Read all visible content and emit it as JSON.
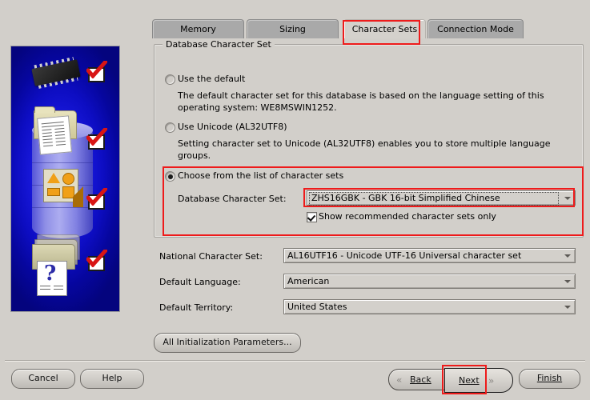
{
  "window": {
    "background_color": "#d2cfca",
    "accent_highlight_color": "#ee1b1b"
  },
  "sidebar": {
    "illustration_name": "oracle-dbca-database-illustration",
    "background_color": "#0d0dc2",
    "items": [
      {
        "icon": "memory-chip-icon",
        "status_icon": "red-check-arrow-icon"
      },
      {
        "icon": "folder-with-documents-icon",
        "status_icon": "red-check-arrow-icon"
      },
      {
        "icon": "orange-shapes-tile-icon",
        "status_icon": "red-check-arrow-icon"
      },
      {
        "icon": "folders-stack-question-icon",
        "status_icon": "red-check-arrow-icon"
      }
    ]
  },
  "tabs": [
    {
      "label": "Memory",
      "active": false,
      "name": "tab-memory"
    },
    {
      "label": "Sizing",
      "active": false,
      "name": "tab-sizing"
    },
    {
      "label": "Character Sets",
      "active": true,
      "name": "tab-character-sets"
    },
    {
      "label": "Connection Mode",
      "active": false,
      "name": "tab-connection-mode"
    }
  ],
  "group": {
    "title": "Database Character Set",
    "options": [
      {
        "id": "use-the-default",
        "label": "Use the default",
        "selected": false,
        "description": "The default character set for this database is based on the language setting of this operating system: WE8MSWIN1252."
      },
      {
        "id": "use-unicode",
        "label": "Use Unicode (AL32UTF8)",
        "selected": false,
        "description": "Setting character set to Unicode (AL32UTF8) enables you to store multiple language groups."
      },
      {
        "id": "choose-from-list",
        "label": "Choose from the list of character sets",
        "selected": true,
        "description": ""
      }
    ],
    "database_character_set": {
      "label": "Database Character Set:",
      "value": "ZHS16GBK - GBK 16-bit Simplified Chinese",
      "focused": true
    },
    "show_recommended": {
      "label": "Show recommended character sets only",
      "checked": true
    }
  },
  "fields": [
    {
      "label": "National Character Set:",
      "value": "AL16UTF16 - Unicode UTF-16 Universal character set",
      "name": "national-character-set"
    },
    {
      "label": "Default Language:",
      "value": "American",
      "name": "default-language"
    },
    {
      "label": "Default Territory:",
      "value": "United States",
      "name": "default-territory"
    }
  ],
  "buttons": {
    "all_init_params": "All Initialization Parameters...",
    "cancel": "Cancel",
    "help": "Help",
    "back": "Back",
    "next": "Next",
    "finish": "Finish",
    "back_chevron": "«",
    "next_chevron": "»"
  }
}
